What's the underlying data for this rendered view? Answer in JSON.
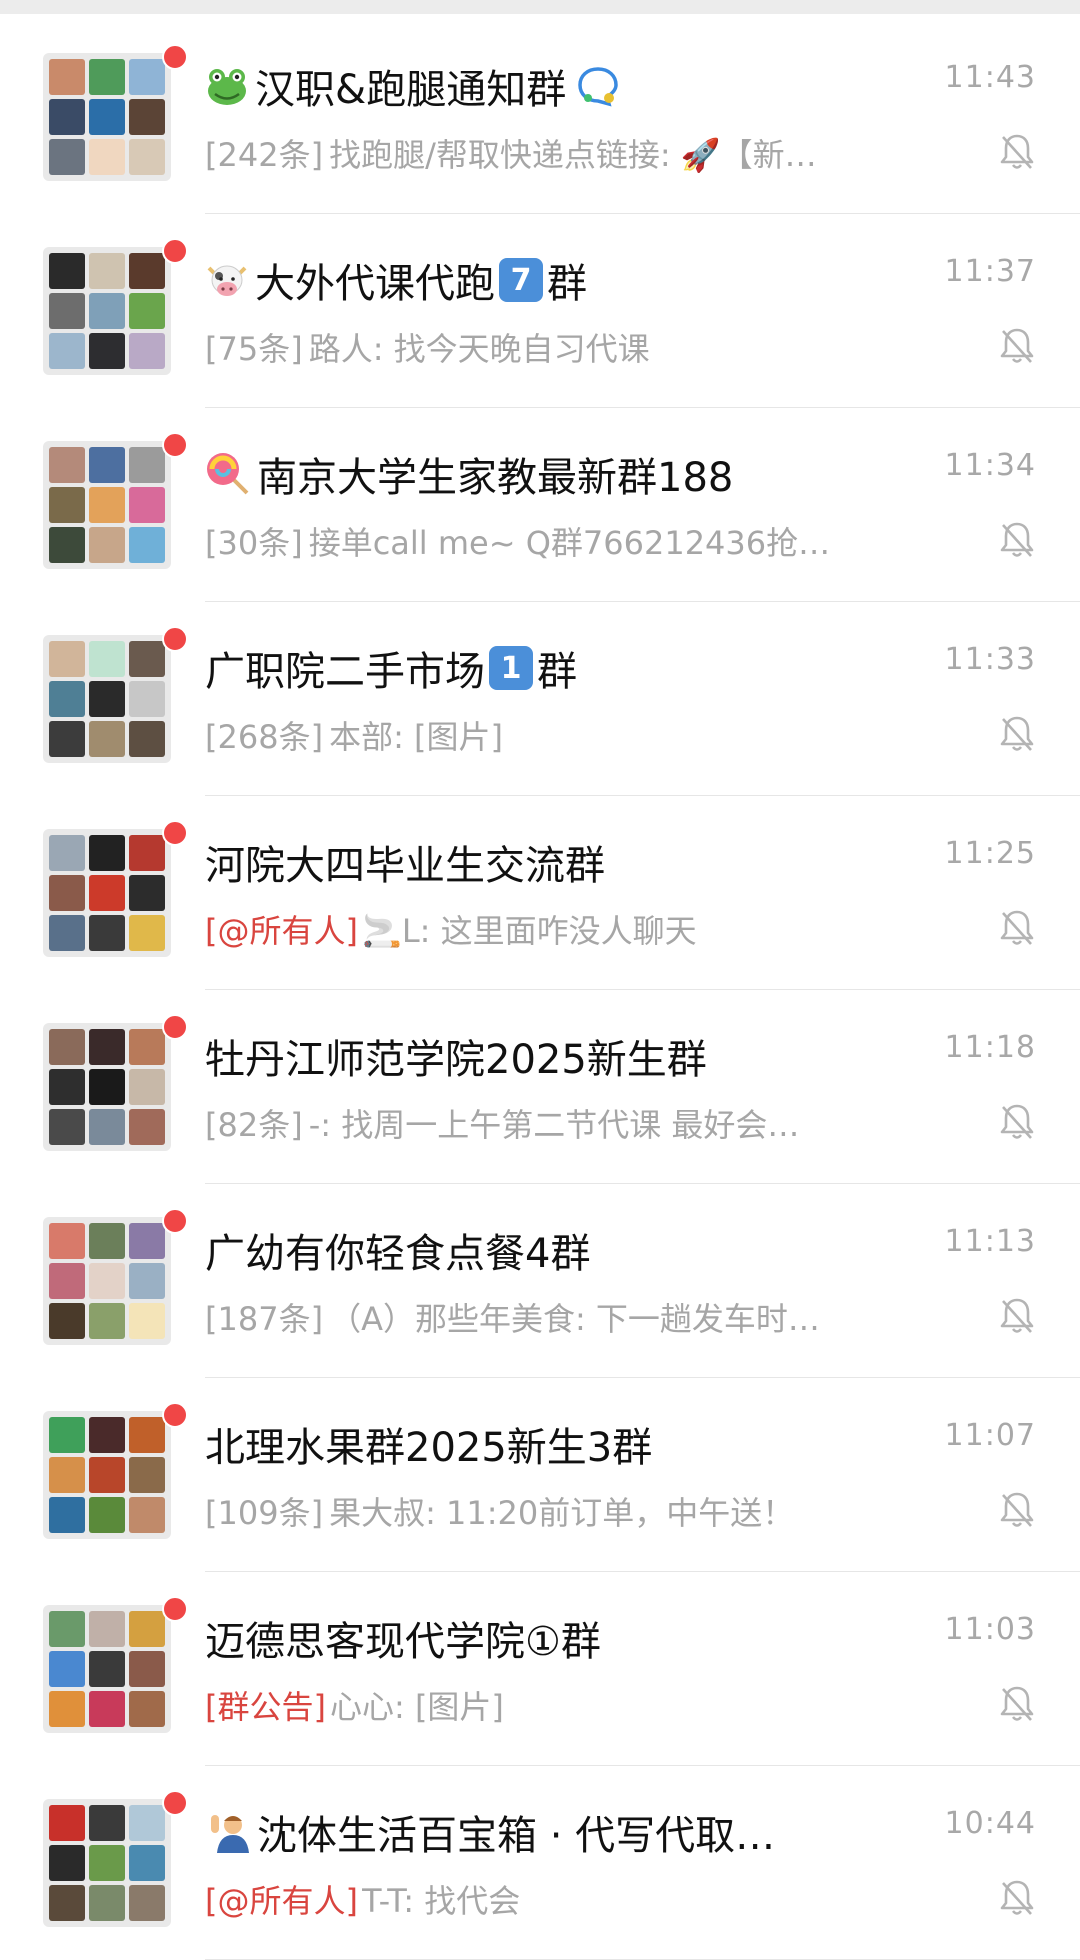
{
  "chats": [
    {
      "title": "汉职&跑腿通知群",
      "lead_icon": "frog-emoji-icon",
      "tail_icon": "chat-bubble-icon",
      "time": "11:43",
      "count": "[242条]",
      "tag": "",
      "message": "找跑腿/帮取快递点链接: 🚀【新…",
      "muted": true
    },
    {
      "title": "大外代课代跑",
      "lead_icon": "cow-emoji-icon",
      "badge": "7",
      "title_tail": "群",
      "time": "11:37",
      "count": "[75条]",
      "tag": "",
      "message": "路人: 找今天晚自习代课",
      "muted": true
    },
    {
      "title": "南京大学生家教最新群188",
      "lead_icon": "lollipop-emoji-icon",
      "time": "11:34",
      "count": "[30条]",
      "tag": "",
      "message": "接单call me~ Q群766212436抢…",
      "muted": true
    },
    {
      "title": "广职院二手市场",
      "badge": "1",
      "title_tail": "群",
      "time": "11:33",
      "count": "[268条]",
      "tag": "",
      "message": "本部: [图片]",
      "muted": true
    },
    {
      "title": "河院大四毕业生交流群",
      "time": "11:25",
      "count": "",
      "tag": "[@所有人]",
      "message": "🚬L: 这里面咋没人聊天",
      "muted": true
    },
    {
      "title": "牡丹江师范学院2025新生群",
      "time": "11:18",
      "count": "[82条]",
      "tag": "",
      "message": "-: 找周一上午第二节代课 最好会…",
      "muted": true
    },
    {
      "title": "广幼有你轻食点餐4群",
      "time": "11:13",
      "count": "[187条]",
      "tag": "",
      "message": "（A）那些年美食: 下一趟发车时…",
      "muted": true
    },
    {
      "title": "北理水果群2025新生3群",
      "time": "11:07",
      "count": "[109条]",
      "tag": "",
      "message": "果大叔: 11:20前订单，中午送！",
      "muted": true
    },
    {
      "title": "迈德思客现代学院①群",
      "time": "11:03",
      "count": "",
      "tag": "[群公告]",
      "message": "心心: [图片]",
      "muted": true
    },
    {
      "title": "沈体生活百宝箱 · 代写代取…",
      "lead_icon": "person-raising-hand-emoji-icon",
      "time": "10:44",
      "count": "",
      "tag": "[@所有人]",
      "message": "T-T: 找代会",
      "muted": true
    }
  ],
  "avatar_palettes": [
    [
      "#c98a6a",
      "#4f9b5a",
      "#8fb4d6",
      "#3a4b66",
      "#2b6ea8",
      "#5b4436",
      "#6b7480",
      "#f0d7c0",
      "#d8c9b6"
    ],
    [
      "#2a2a2a",
      "#cfc3b0",
      "#5a3a2c",
      "#6d6d6d",
      "#7fa0b8",
      "#6aa54c",
      "#9cb6cc",
      "#2d2d30",
      "#b9a9c6"
    ],
    [
      "#b48a7a",
      "#4d6fa0",
      "#9b9b9b",
      "#7a6a4a",
      "#e3a25a",
      "#d86a9a",
      "#3d4a3a",
      "#c7a68a",
      "#6fb0d8"
    ],
    [
      "#d1b59a",
      "#bfe3d0",
      "#6a5a4e",
      "#4f7f95",
      "#2a2a2a",
      "#c7c7c7",
      "#3c3c3c",
      "#a08c6e",
      "#5d4f42"
    ],
    [
      "#9aa7b4",
      "#222222",
      "#b5392f",
      "#8a5a4a",
      "#cc3a2a",
      "#2c2c2c",
      "#59708a",
      "#3a3a3a",
      "#e0b84a"
    ],
    [
      "#8a6a5a",
      "#3a2a2a",
      "#b87a5a",
      "#2e2e2e",
      "#1a1a1a",
      "#c7b8a8",
      "#4a4a4a",
      "#7a8a9a",
      "#a06a5a"
    ],
    [
      "#d87a6a",
      "#6b7f5a",
      "#8a7aa6",
      "#c06a7a",
      "#e3d2c8",
      "#9ab0c4",
      "#4a3a2a",
      "#8aa06a",
      "#f4e4b8"
    ],
    [
      "#3fa05a",
      "#4a2a2a",
      "#c0602a",
      "#d6904a",
      "#b8462a",
      "#8a6a4a",
      "#2f6fa0",
      "#5a8a3a",
      "#c08a6a"
    ],
    [
      "#6a9a6a",
      "#c0b0a8",
      "#d4a040",
      "#4a88d0",
      "#3a3a3a",
      "#8a5a4a",
      "#e0903a",
      "#c83a5a",
      "#a06a4a"
    ],
    [
      "#c8302a",
      "#3a3a3a",
      "#b0c8d8",
      "#2a2a2a",
      "#6a9a4a",
      "#4a8ab0",
      "#5a4a3a",
      "#7a8a6a",
      "#8a7a6a"
    ]
  ]
}
